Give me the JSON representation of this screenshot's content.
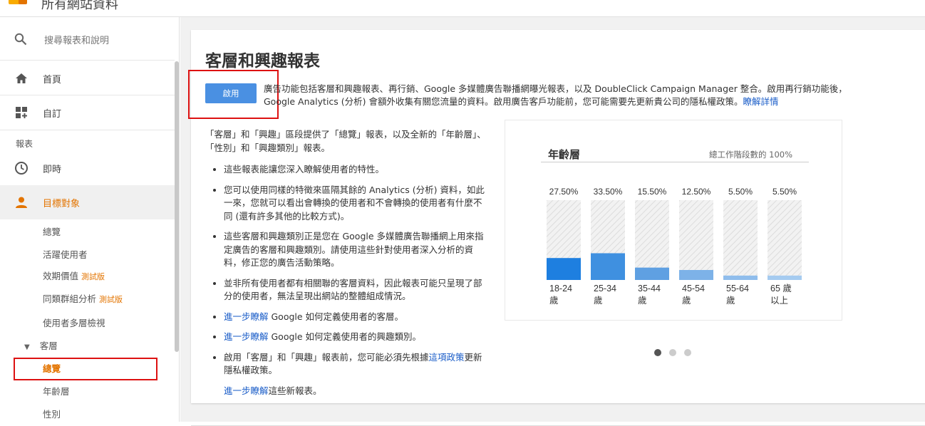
{
  "topbar": {
    "title": "所有網站資料"
  },
  "sidebar": {
    "search_label": "搜尋報表和說明",
    "home": "首頁",
    "custom": "自訂",
    "reports_section": "報表",
    "realtime": "即時",
    "audience": "目標對象",
    "sub": {
      "overview": "總覽",
      "active_users": "活躍使用者",
      "lifetime_value": "效期價值",
      "lifetime_value_beta": "測試版",
      "cohort": "同類群組分析",
      "cohort_beta": "測試版",
      "user_explorer": "使用者多層檢視",
      "demographics": "客層",
      "demo_overview": "總覽",
      "age": "年齡層",
      "gender": "性別"
    }
  },
  "main": {
    "title": "客層和興趣報表",
    "enable_button": "啟用",
    "intro_text_1": "廣告功能包括客層和興趣報表、再行銷、Google 多媒體廣告聯播網曝光報表，以及 DoubleClick Campaign Manager 整合。啟用再行銷功能後，Google Analytics (分析) 會額外收集有關您流量的資料。啟用廣告客戶功能前，您可能需要先更新貴公司的隱私權政策。",
    "intro_link": "瞭解詳情",
    "lead": "「客層」和「興趣」區段提供了「總覽」報表，以及全新的「年齡層」、「性別」和「興趣類別」報表。",
    "bullets": {
      "b1": "這些報表能讓您深入瞭解使用者的特性。",
      "b2": "您可以使用同樣的特徵來區隔其餘的 Analytics (分析) 資料，如此一來，您就可以看出會轉換的使用者和不會轉換的使用者有什麼不同 (還有許多其他的比較方式)。",
      "b3": "這些客層和興趣類別正是您在 Google 多媒體廣告聯播網上用來指定廣告的客層和興趣類別。請使用這些針對使用者深入分析的資料，修正您的廣告活動策略。",
      "b4": "並非所有使用者都有相關聯的客層資料，因此報表可能只呈現了部分的使用者，無法呈現出網站的整體組成情況。",
      "b5_link": "進一步瞭解",
      "b5_text": " Google 如何定義使用者的客層。",
      "b6_link": "進一步瞭解",
      "b6_text": " Google 如何定義使用者的興趣類別。",
      "b7_pre": "啟用「客層」和「興趣」報表前，您可能必須先根據",
      "b7_link": "這項政策",
      "b7_post": "更新隱私權政策。"
    },
    "footer_link": "進一步瞭解",
    "footer_text": "這些新報表。"
  },
  "chart_data": {
    "type": "bar",
    "title": "年齡層",
    "subtitle": "總工作階段數的 100%",
    "categories": [
      "18-24 歲",
      "25-34 歲",
      "35-44 歲",
      "45-54 歲",
      "55-64 歲",
      "65 歲以上"
    ],
    "category_lines": [
      [
        "18-24",
        "歲"
      ],
      [
        "25-34",
        "歲"
      ],
      [
        "35-44",
        "歲"
      ],
      [
        "45-54",
        "歲"
      ],
      [
        "55-64",
        "歲"
      ],
      [
        "65 歲",
        "以上"
      ]
    ],
    "values": [
      27.5,
      33.5,
      15.5,
      12.5,
      5.5,
      5.5
    ],
    "value_labels": [
      "27.50%",
      "33.50%",
      "15.50%",
      "12.50%",
      "5.50%",
      "5.50%"
    ],
    "ylim": [
      0,
      100
    ],
    "colors": [
      "#1e7fe0",
      "#3f90e0",
      "#5fa0e2",
      "#7db2e8",
      "#8fbdec",
      "#a5cbf0"
    ]
  },
  "carousel": {
    "count": 3,
    "active": 0
  }
}
